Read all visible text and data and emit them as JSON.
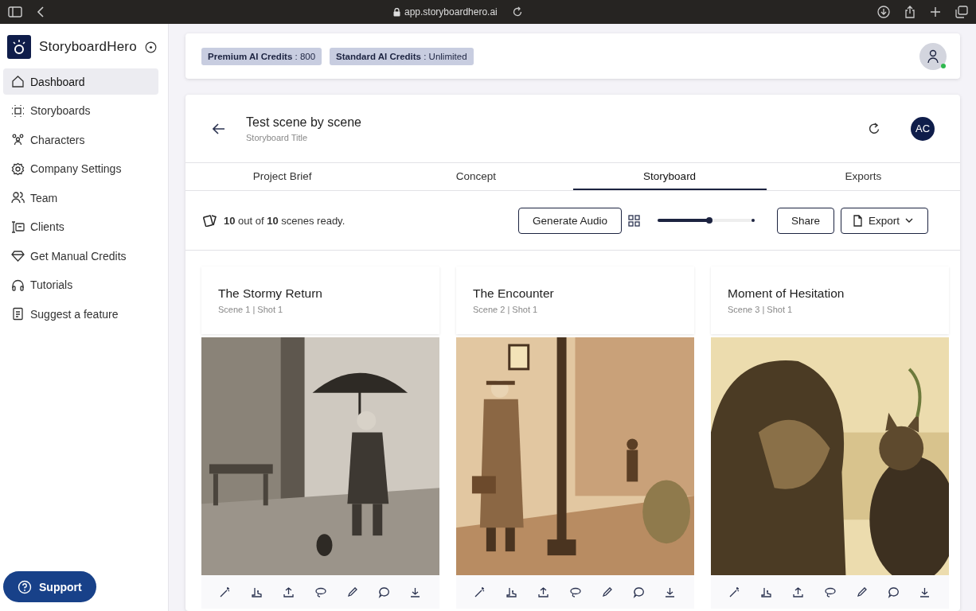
{
  "browser": {
    "url": "app.storyboardhero.ai"
  },
  "sidebar": {
    "brand": "StoryboardHero",
    "items": [
      {
        "label": "Dashboard",
        "selected": true
      },
      {
        "label": "Storyboards",
        "selected": false
      },
      {
        "label": "Characters",
        "selected": false
      },
      {
        "label": "Company Settings",
        "selected": false
      },
      {
        "label": "Team",
        "selected": false
      },
      {
        "label": "Clients",
        "selected": false
      },
      {
        "label": "Get Manual Credits",
        "selected": false
      },
      {
        "label": "Tutorials",
        "selected": false
      },
      {
        "label": "Suggest a feature",
        "selected": false
      }
    ],
    "support": "Support"
  },
  "credits": [
    {
      "label": "Premium AI Credits",
      "value": " : 800"
    },
    {
      "label": "Standard AI Credits",
      "value": " : Unlimited"
    }
  ],
  "project": {
    "title": "Test scene by scene",
    "subtitle": "Storyboard Title",
    "avatar": "AC"
  },
  "tabs": [
    {
      "label": "Project Brief",
      "selected": false
    },
    {
      "label": "Concept",
      "selected": false
    },
    {
      "label": "Storyboard",
      "selected": true
    },
    {
      "label": "Exports",
      "selected": false
    }
  ],
  "toolbar": {
    "status": "**10** out of **10** scenes ready.",
    "generate": "Generate Audio",
    "zoom": {
      "level": 0.53
    },
    "share": "Share",
    "export": "Export"
  },
  "scenes": [
    {
      "title": "The Stormy Return",
      "meta": "Scene 1 | Shot 1"
    },
    {
      "title": "The Encounter",
      "meta": "Scene 2 | Shot 1"
    },
    {
      "title": "Moment of Hesitation",
      "meta": "Scene 3 | Shot 1"
    }
  ]
}
